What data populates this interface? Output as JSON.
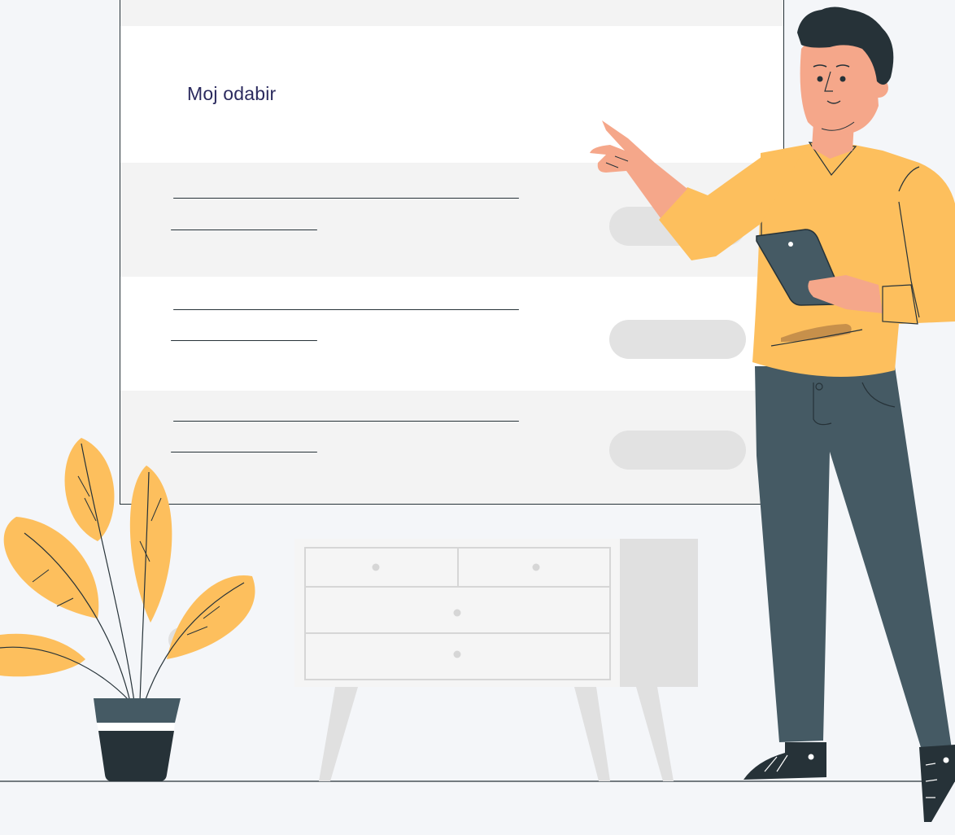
{
  "panel": {
    "title": "Moj odabir",
    "rows": [
      {
        "action": ""
      },
      {
        "action": ""
      },
      {
        "action": ""
      }
    ]
  },
  "colors": {
    "background": "#f4f6f9",
    "panel": "#f3f3f3",
    "panel_header": "#ffffff",
    "title_text": "#2b2a5e",
    "outline": "#263238",
    "accent_yellow": "#fdbf5d",
    "pants": "#455a64",
    "pill": "#e2e2e2"
  },
  "icons": [
    "person-illustration",
    "plant-illustration",
    "dresser-illustration",
    "tablet-icon"
  ]
}
